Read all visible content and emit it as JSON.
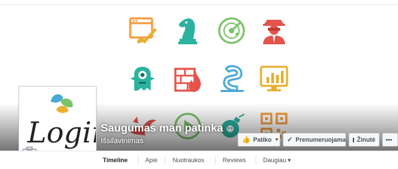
{
  "page": {
    "name": "Saugumas man patinka",
    "category": "Išsilavinimas",
    "profile_logo_text": "Login"
  },
  "actions": {
    "like_label": "Patiko",
    "follow_label": "Prenumeruojama",
    "message_label": "Žinutė",
    "more_label": "•••"
  },
  "tabs": [
    {
      "label": "Timeline",
      "active": true
    },
    {
      "label": "Apie",
      "active": false
    },
    {
      "label": "Nuotraukos",
      "active": false
    },
    {
      "label": "Reviews",
      "active": false
    },
    {
      "label": "Daugiau ▾",
      "active": false
    }
  ],
  "cover_icons": [
    "browser-edit-icon",
    "chess-knight-icon",
    "radar-icon",
    "hacker-icon",
    "monster-icon",
    "firewall-icon",
    "worm-icon",
    "chart-monitor-icon",
    "dragon-icon",
    "play-icon",
    "bomb-icon",
    "qr-code-icon"
  ],
  "colors": {
    "orange": "#f39c3c",
    "teal": "#2bb3a0",
    "green": "#7ac36a",
    "red": "#e5534b",
    "gold": "#e8b030",
    "link": "#365899",
    "text": "#4b4f56"
  }
}
